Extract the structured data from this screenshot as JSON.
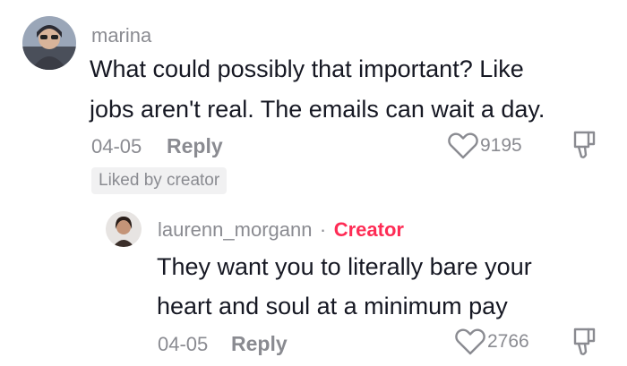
{
  "comments": [
    {
      "username": "marina",
      "lines": [
        "What could possibly that important? Like",
        "jobs aren't real. The emails can wait a day."
      ],
      "date": "04-05",
      "reply_label": "Reply",
      "likes": "9195",
      "liked_by_creator_label": "Liked by creator"
    }
  ],
  "reply_comment": {
    "username": "laurenn_morgann",
    "separator": "·",
    "creator_label": "Creator",
    "lines": [
      "They want you to literally bare your",
      "heart and soul at a minimum pay"
    ],
    "date": "04-05",
    "reply_label": "Reply",
    "likes": "2766"
  },
  "colors": {
    "accent_creator": "#fe2c55",
    "secondary_text": "#8a8b91",
    "primary_text": "#161823"
  }
}
